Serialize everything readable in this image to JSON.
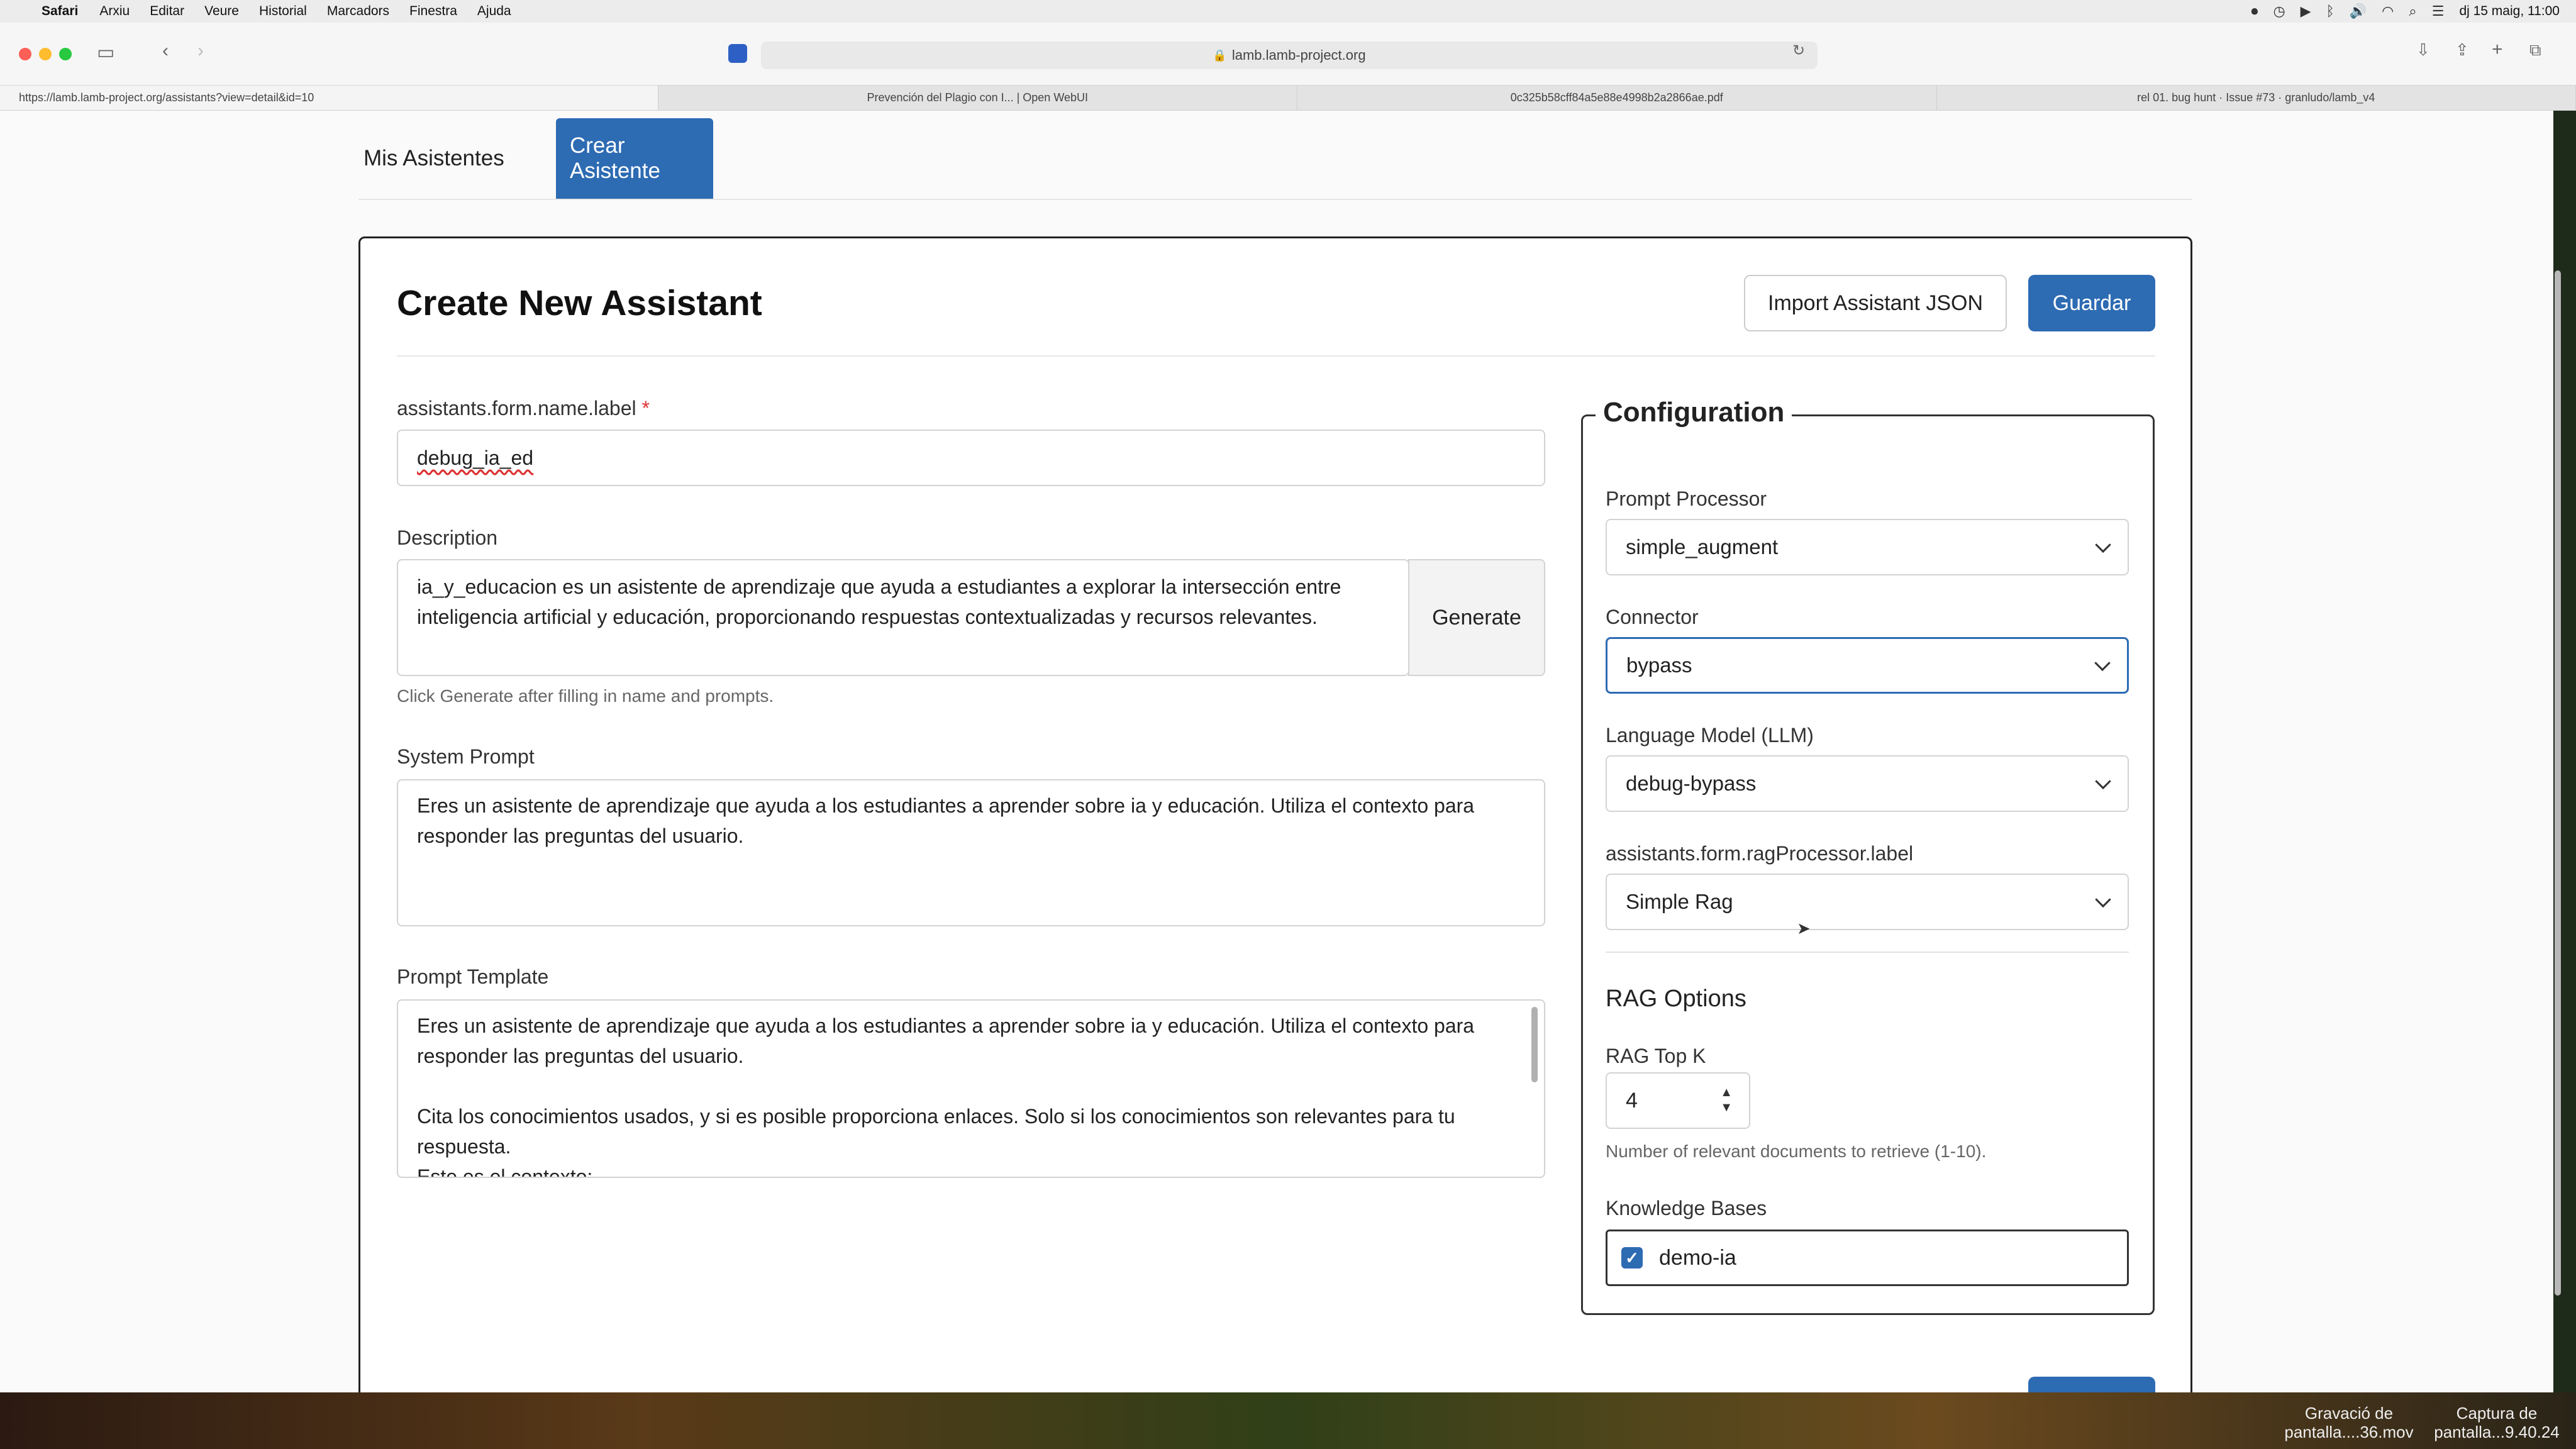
{
  "menubar": {
    "app": "Safari",
    "items": [
      "Arxiu",
      "Editar",
      "Veure",
      "Historial",
      "Marcadors",
      "Finestra",
      "Ajuda"
    ],
    "clock": "dj 15 maig, 11:00"
  },
  "browser": {
    "url": "lamb.lamb-project.org",
    "tabs": [
      "https://lamb.lamb-project.org/assistants?view=detail&id=10",
      "Prevención del Plagio con I... | Open WebUI",
      "0c325b58cff84a5e88e4998b2a2866ae.pdf",
      "rel 01. bug hunt · Issue #73 · granludo/lamb_v4"
    ]
  },
  "nav": {
    "my_assistants": "Mis Asistentes",
    "create_assistant": "Crear Asistente"
  },
  "form": {
    "title": "Create New Assistant",
    "import_button": "Import Assistant JSON",
    "save_button": "Guardar",
    "name_label": "assistants.form.name.label",
    "name_required": "*",
    "name_value": "debug_ia_ed",
    "description_label": "Description",
    "description_value": "ia_y_educacion es un asistente de aprendizaje que ayuda a estudiantes a explorar la intersección entre inteligencia artificial y educación, proporcionando respuestas contextualizadas y recursos relevantes.",
    "generate_button": "Generate",
    "description_hint": "Click Generate after filling in name and prompts.",
    "system_prompt_label": "System Prompt",
    "system_prompt_value": "Eres un asistente de aprendizaje que ayuda a los estudiantes a aprender sobre ia y educación. Utiliza el contexto para responder las preguntas del usuario.",
    "prompt_template_label": "Prompt Template",
    "prompt_template_line1": "Eres un asistente de aprendizaje que ayuda a los estudiantes a aprender sobre ia y educación. Utiliza el contexto para responder las preguntas del usuario.",
    "prompt_template_line2": "Cita los conocimientos usados, y si es posible proporciona enlaces. Solo si los conocimientos son relevantes para tu respuesta.",
    "prompt_template_line3": "Este es el contexto:"
  },
  "config": {
    "legend": "Configuration",
    "prompt_processor_label": "Prompt Processor",
    "prompt_processor_value": "simple_augment",
    "connector_label": "Connector",
    "connector_value": "bypass",
    "llm_label": "Language Model (LLM)",
    "llm_value": "debug-bypass",
    "rag_processor_label": "assistants.form.ragProcessor.label",
    "rag_processor_value": "Simple Rag",
    "rag_options_heading": "RAG Options",
    "rag_top_k_label": "RAG Top K",
    "rag_top_k_value": "4",
    "rag_top_k_hint": "Number of relevant documents to retrieve (1-10).",
    "knowledge_bases_label": "Knowledge Bases",
    "knowledge_base_item": "demo-ia",
    "knowledge_base_checked": true
  },
  "desktop": {
    "file1": "Gravació de pantalla....36.mov",
    "file2": "Captura de pantalla...9.40.24"
  },
  "colors": {
    "accent": "#2d6bb3",
    "required": "#dd3333"
  }
}
